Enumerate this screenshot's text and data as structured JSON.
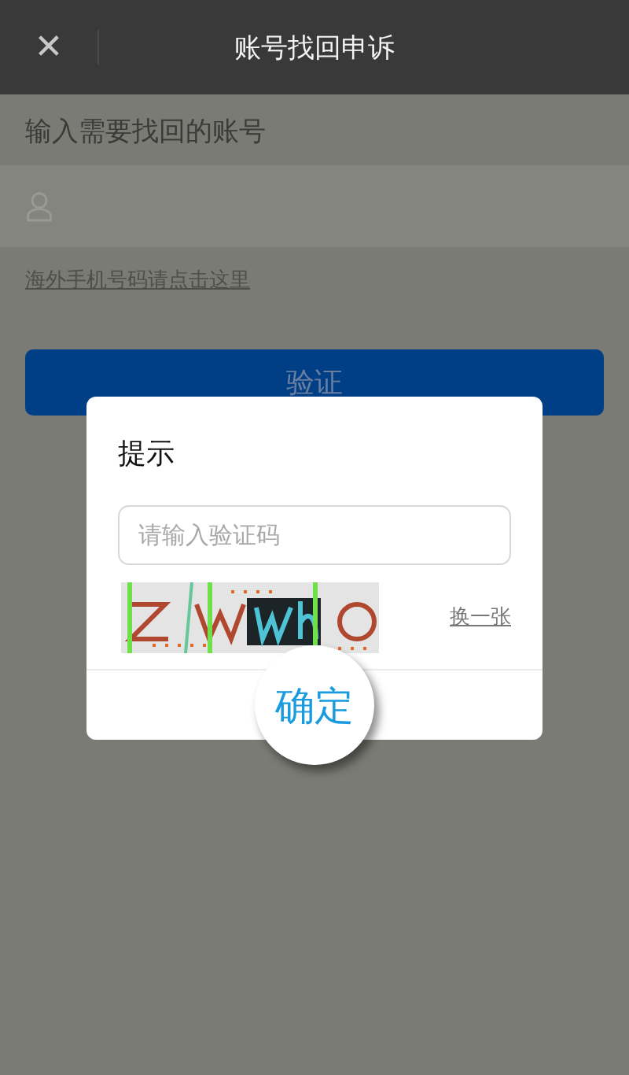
{
  "header": {
    "close": "✕",
    "title": "账号找回申诉"
  },
  "form": {
    "label": "输入需要找回的账号",
    "overseas_link": "海外手机号码请点击这里",
    "verify_button": "验证"
  },
  "dialog": {
    "title": "提示",
    "code_field": {
      "placeholder": "请输入验证码"
    },
    "refresh_link": "换一张",
    "confirm_button": "确定"
  }
}
